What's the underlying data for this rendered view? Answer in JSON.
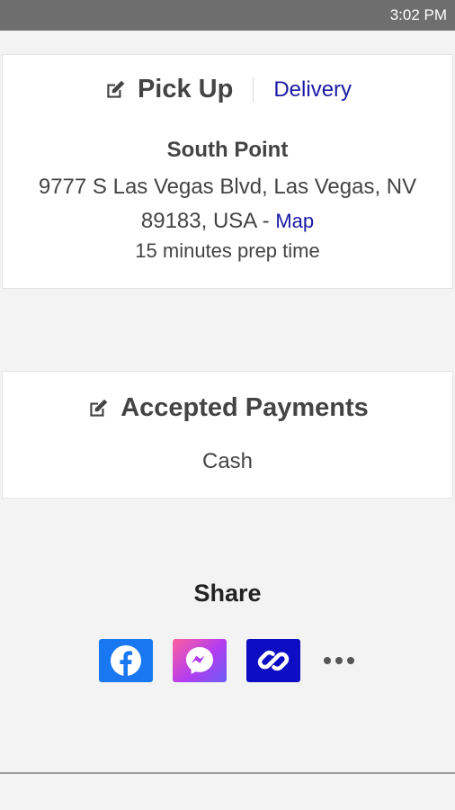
{
  "status_bar": {
    "time": "3:02 PM"
  },
  "order_mode": {
    "pickup_label": "Pick Up",
    "delivery_label": "Delivery",
    "icon": "edit-icon"
  },
  "location": {
    "name": "South Point",
    "address_line1": "9777 S Las Vegas Blvd, Las Vegas, NV",
    "address_line2": "89183, USA -",
    "map_label": "Map",
    "prep_time": "15 minutes prep time"
  },
  "payments": {
    "title": "Accepted Payments",
    "value": "Cash",
    "icon": "edit-icon"
  },
  "share": {
    "title": "Share",
    "buttons": [
      {
        "name": "facebook",
        "icon": "facebook-icon",
        "color": "#1977f2"
      },
      {
        "name": "messenger",
        "icon": "messenger-icon",
        "color": "#b23df0"
      },
      {
        "name": "copy-link",
        "icon": "link-icon",
        "color": "#0d0dc4"
      },
      {
        "name": "more",
        "icon": "more-dots-icon",
        "color": "#555555"
      }
    ]
  },
  "colors": {
    "link": "#1a1aa6",
    "text": "#444444",
    "background": "#f3f3f3"
  }
}
